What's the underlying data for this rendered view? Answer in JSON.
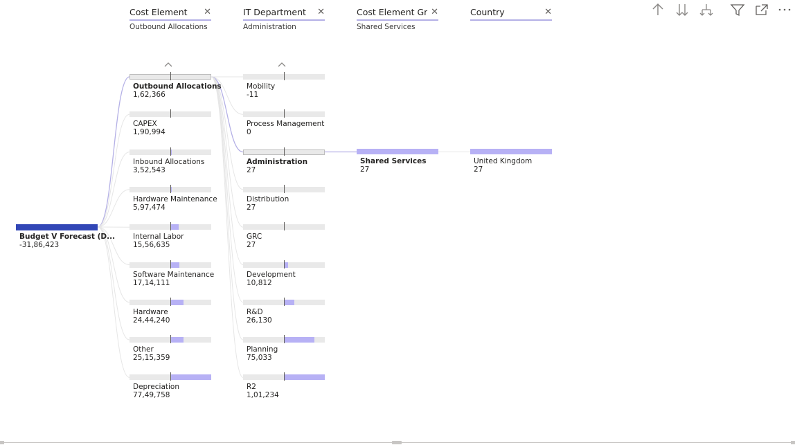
{
  "colors": {
    "accent": "#b7b1f5",
    "root_bar": "#3146b6",
    "track": "#e9e9e9",
    "connector": "#b4b0e6"
  },
  "toolbar": {
    "icons": [
      "drill-up-icon",
      "drill-down-next-level-icon",
      "expand-all-down-icon",
      "filter-icon",
      "focus-mode-icon",
      "more-options-icon"
    ]
  },
  "columns": [
    {
      "title": "Cost Element",
      "selected": "Outbound Allocations"
    },
    {
      "title": "IT Department",
      "selected": "Administration"
    },
    {
      "title": "Cost Element Gr...",
      "selected": "Shared Services"
    },
    {
      "title": "Country",
      "selected": ""
    }
  ],
  "root": {
    "label": "Budget V Forecast (D...",
    "value": "-31,86,423"
  },
  "cost_element_nodes": [
    {
      "label": "Outbound Allocations",
      "value": "1,62,366",
      "fill_fraction": 0.0
    },
    {
      "label": "CAPEX",
      "value": "1,90,994",
      "fill_fraction": 0.0
    },
    {
      "label": "Inbound Allocations",
      "value": "3,52,543",
      "fill_fraction": 0.01
    },
    {
      "label": "Hardware Maintenance",
      "value": "5,97,474",
      "fill_fraction": 0.04
    },
    {
      "label": "Internal Labor",
      "value": "15,56,635",
      "fill_fraction": 0.2
    },
    {
      "label": "Software Maintenance",
      "value": "17,14,111",
      "fill_fraction": 0.22
    },
    {
      "label": "Hardware",
      "value": "24,44,240",
      "fill_fraction": 0.32
    },
    {
      "label": "Other",
      "value": "25,15,359",
      "fill_fraction": 0.32
    },
    {
      "label": "Depreciation",
      "value": "77,49,758",
      "fill_fraction": 1.0
    }
  ],
  "it_department_nodes": [
    {
      "label": "Mobility",
      "value": "-11",
      "fill_fraction": 0.0
    },
    {
      "label": "Process Management",
      "value": "0",
      "fill_fraction": 0.0
    },
    {
      "label": "Administration",
      "value": "27",
      "fill_fraction": 0.0
    },
    {
      "label": "Distribution",
      "value": "27",
      "fill_fraction": 0.0
    },
    {
      "label": "GRC",
      "value": "27",
      "fill_fraction": 0.0
    },
    {
      "label": "Development",
      "value": "10,812",
      "fill_fraction": 0.11
    },
    {
      "label": "R&D",
      "value": "26,130",
      "fill_fraction": 0.26
    },
    {
      "label": "Planning",
      "value": "75,033",
      "fill_fraction": 0.74
    },
    {
      "label": "R2",
      "value": "1,01,234",
      "fill_fraction": 1.0
    }
  ],
  "cost_element_group_node": {
    "label": "Shared Services",
    "value": "27"
  },
  "country_node": {
    "label": "United Kingdom",
    "value": "27"
  }
}
